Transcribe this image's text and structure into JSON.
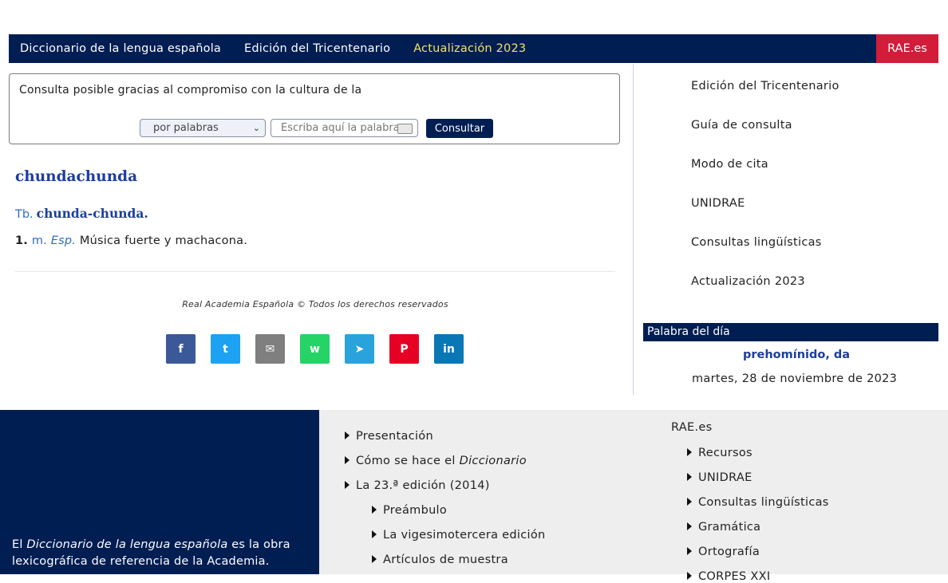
{
  "topnav": {
    "links": [
      "Diccionario de la lengua española",
      "Edición del Tricentenario",
      "Actualización 2023"
    ],
    "rae_button": "RAE.es"
  },
  "search": {
    "sponsor_text": "Consulta posible gracias al compromiso con la cultura de la",
    "mode_value": "por palabras",
    "input_placeholder": "Escriba aquí la palabra",
    "button_label": "Consultar"
  },
  "entry": {
    "headword": "chundachunda",
    "variant_abbr": "Tb.",
    "variant_form": "chunda-chunda.",
    "definition_num": "1.",
    "definition_pos": "m.",
    "definition_region": "Esp.",
    "definition_text": "Música fuerte y machacona."
  },
  "copyright": "Real Academia Española © Todos los derechos reservados",
  "share": [
    {
      "name": "facebook",
      "glyph": "f",
      "color": "#3b5998"
    },
    {
      "name": "twitter",
      "glyph": "t",
      "color": "#1da1f2"
    },
    {
      "name": "email",
      "glyph": "✉",
      "color": "#7f7f7f"
    },
    {
      "name": "whatsapp",
      "glyph": "w",
      "color": "#25d366"
    },
    {
      "name": "telegram",
      "glyph": "➤",
      "color": "#2aa3dc"
    },
    {
      "name": "pinterest",
      "glyph": "P",
      "color": "#e60023"
    },
    {
      "name": "linkedin",
      "glyph": "in",
      "color": "#0a77b5"
    }
  ],
  "sidebar": {
    "items": [
      "Edición del Tricentenario",
      "Guía de consulta",
      "Modo de cita",
      "UNIDRAE",
      "Consultas lingüísticas",
      "Actualización 2023"
    ]
  },
  "wotd": {
    "header": "Palabra del día",
    "word": "prehomínido, da",
    "date": "martes, 28 de noviembre de 2023"
  },
  "footer": {
    "blurb_pre": "El ",
    "blurb_italic": "Diccionario de la lengua española",
    "blurb_post": " es la obra lexicográfica de referencia de la Academia.",
    "col1": {
      "presentacion": "Presentación",
      "como_pre": "Cómo se hace el ",
      "como_italic": "Diccionario",
      "edicion": "La 23.ª edición (2014)",
      "preambulo": "Preámbulo",
      "vigesimo": "La vigesimotercera edición",
      "articulos": "Artículos de muestra"
    },
    "col2": {
      "title": "RAE.es",
      "items": [
        "Recursos",
        "UNIDRAE",
        "Consultas lingüísticas",
        "Gramática",
        "Ortografía",
        "CORPES XXI"
      ]
    }
  }
}
